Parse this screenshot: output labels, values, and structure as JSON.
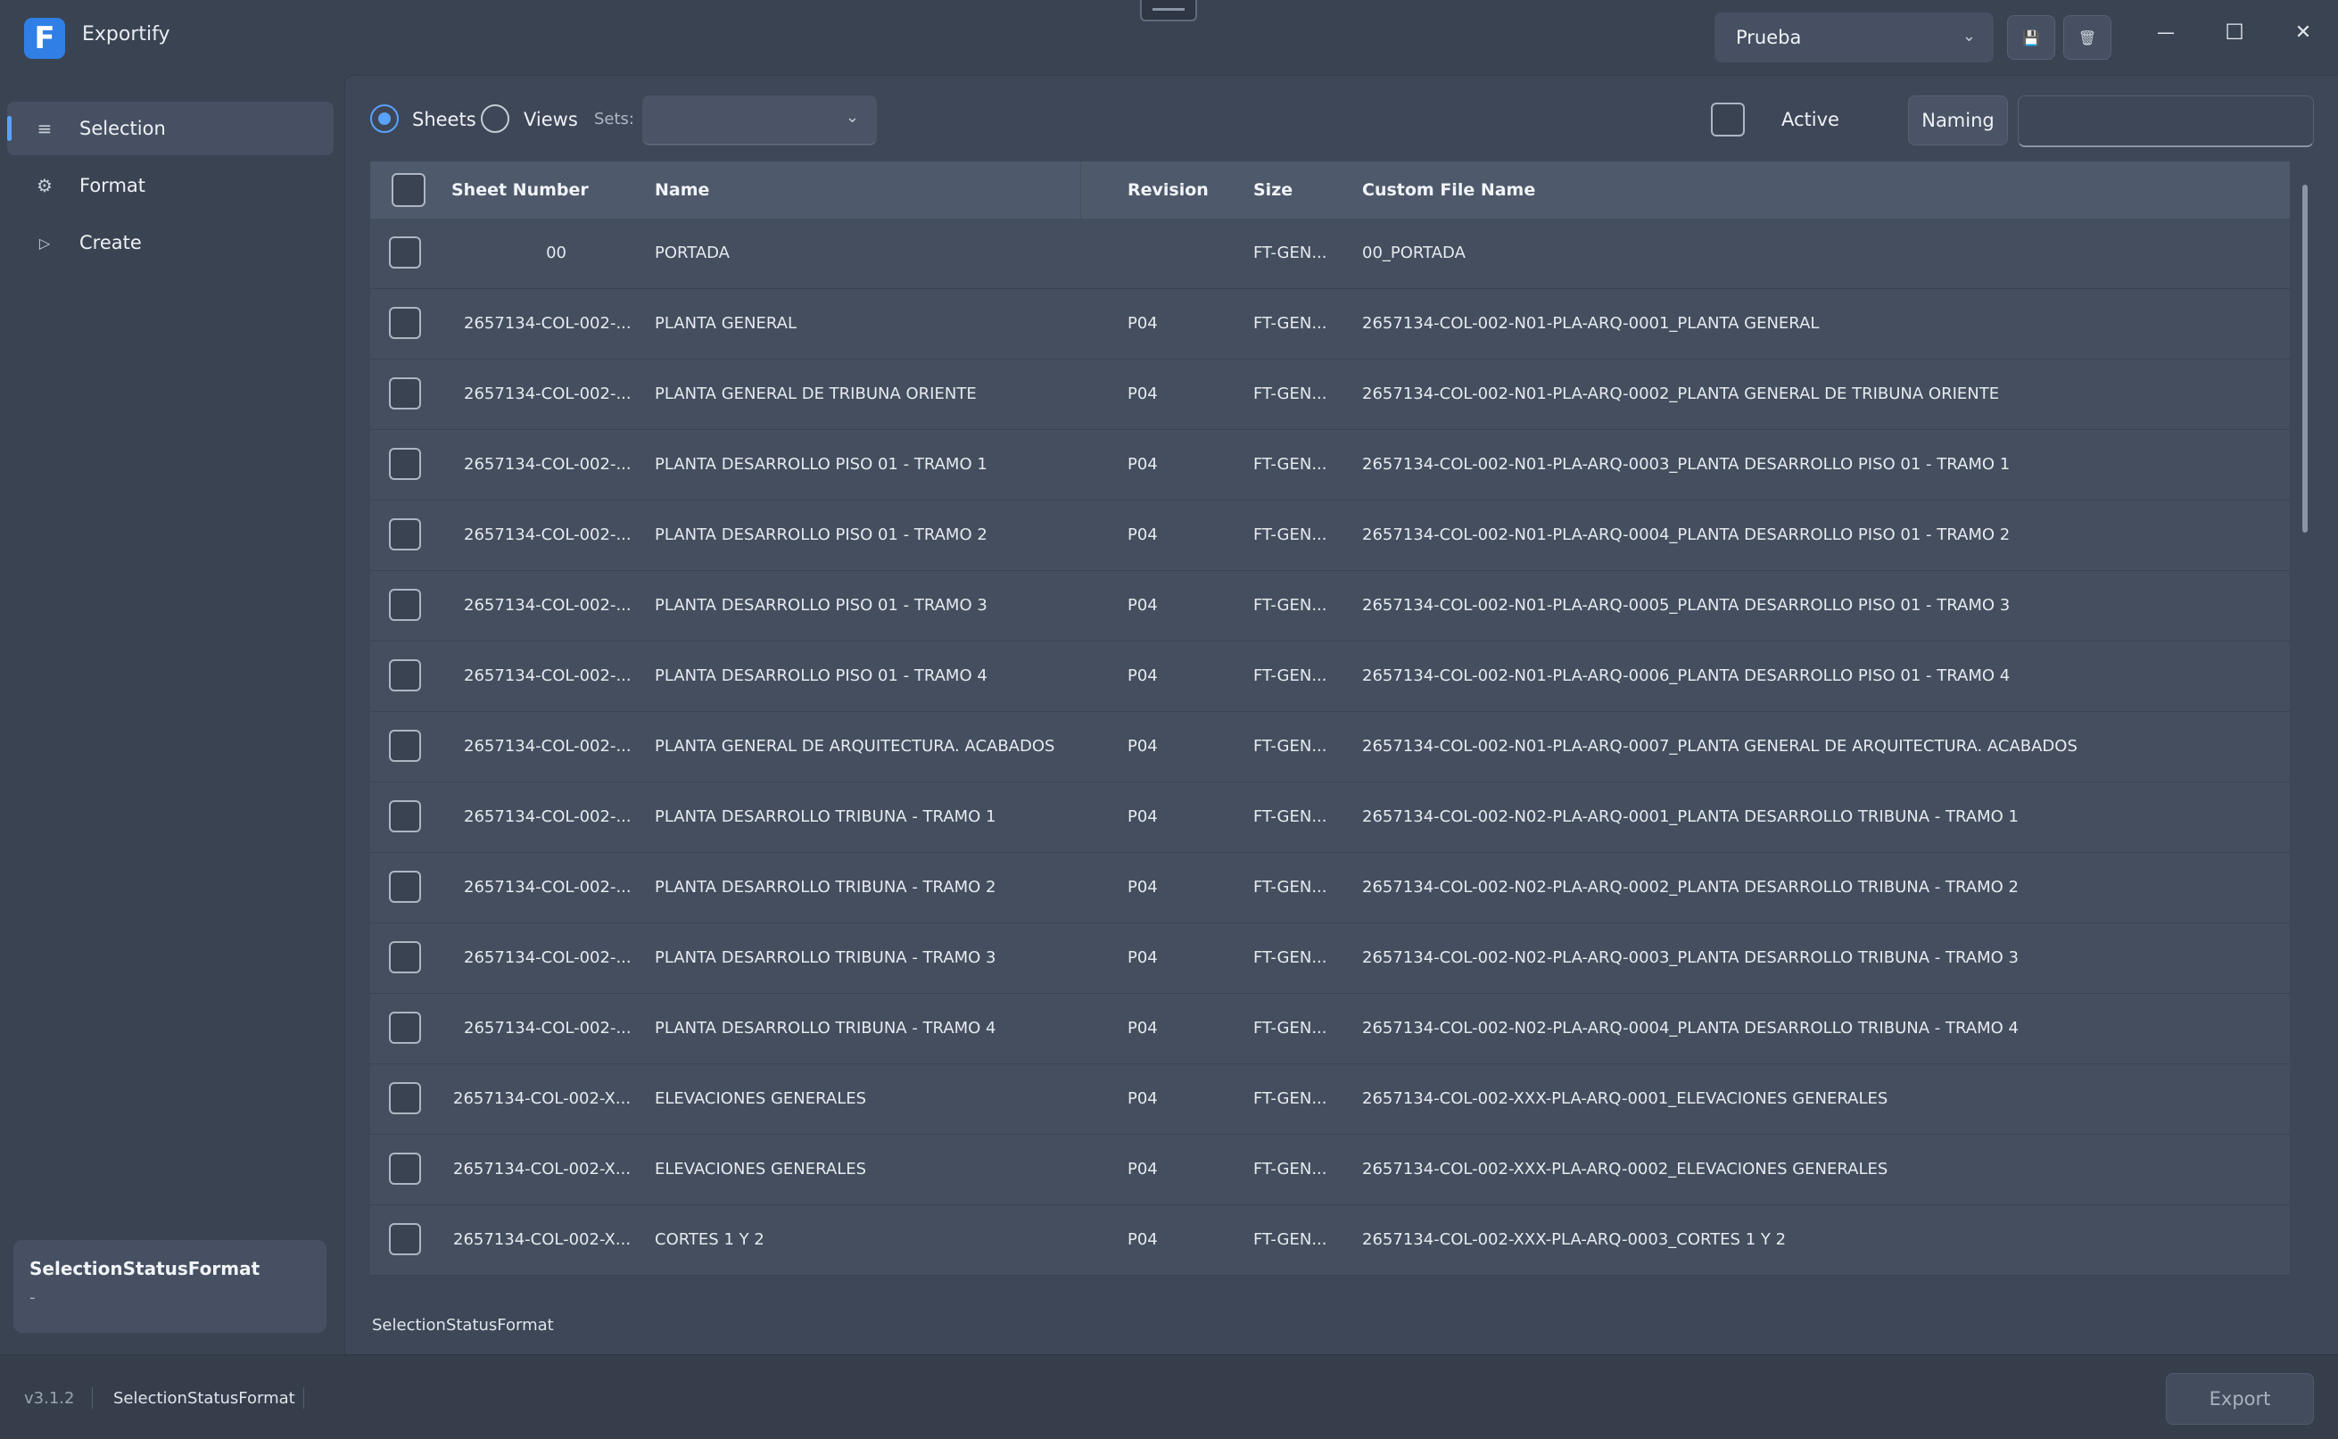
{
  "app": {
    "title": "Exportify",
    "logo_letter": "F",
    "version": "v3.1.2"
  },
  "header": {
    "profile_selected": "Prueba",
    "chevron": "⌄",
    "save_icon": "💾",
    "delete_icon": "🗑",
    "minimize": "—",
    "maximize": "☐",
    "close": "✕"
  },
  "sidebar": {
    "items": [
      {
        "label": "Selection",
        "icon": "≡"
      },
      {
        "label": "Format",
        "icon": "⚙"
      },
      {
        "label": "Create",
        "icon": "▷"
      }
    ],
    "status_card": {
      "title": "SelectionStatusFormat",
      "subtitle": "-"
    }
  },
  "toolbar": {
    "radio_sheets": "Sheets",
    "radio_views": "Views",
    "sets_label": "Sets:",
    "active_label": "Active",
    "naming_button": "Naming"
  },
  "table": {
    "columns": {
      "sheet_number": "Sheet Number",
      "name": "Name",
      "revision": "Revision",
      "size": "Size",
      "custom_file_name": "Custom File Name"
    },
    "rows": [
      {
        "number": "00",
        "name": "PORTADA",
        "revision": "",
        "size": "FT-GEN...",
        "file": "00_PORTADA",
        "align": "right"
      },
      {
        "number": "2657134-COL-002-...",
        "name": "PLANTA GENERAL",
        "revision": "P04",
        "size": "FT-GEN...",
        "file": "2657134-COL-002-N01-PLA-ARQ-0001_PLANTA GENERAL"
      },
      {
        "number": "2657134-COL-002-...",
        "name": "PLANTA GENERAL DE TRIBUNA ORIENTE",
        "revision": "P04",
        "size": "FT-GEN...",
        "file": "2657134-COL-002-N01-PLA-ARQ-0002_PLANTA GENERAL DE TRIBUNA ORIENTE"
      },
      {
        "number": "2657134-COL-002-...",
        "name": "PLANTA DESARROLLO PISO 01 - TRAMO 1",
        "revision": "P04",
        "size": "FT-GEN...",
        "file": "2657134-COL-002-N01-PLA-ARQ-0003_PLANTA DESARROLLO PISO 01 - TRAMO 1"
      },
      {
        "number": "2657134-COL-002-...",
        "name": "PLANTA DESARROLLO PISO 01 - TRAMO 2",
        "revision": "P04",
        "size": "FT-GEN...",
        "file": "2657134-COL-002-N01-PLA-ARQ-0004_PLANTA DESARROLLO PISO 01 - TRAMO 2"
      },
      {
        "number": "2657134-COL-002-...",
        "name": "PLANTA DESARROLLO PISO 01 - TRAMO 3",
        "revision": "P04",
        "size": "FT-GEN...",
        "file": "2657134-COL-002-N01-PLA-ARQ-0005_PLANTA DESARROLLO PISO 01 - TRAMO 3"
      },
      {
        "number": "2657134-COL-002-...",
        "name": "PLANTA DESARROLLO PISO 01 - TRAMO 4",
        "revision": "P04",
        "size": "FT-GEN...",
        "file": "2657134-COL-002-N01-PLA-ARQ-0006_PLANTA DESARROLLO PISO 01 - TRAMO 4"
      },
      {
        "number": "2657134-COL-002-...",
        "name": "PLANTA GENERAL DE ARQUITECTURA. ACABADOS",
        "revision": "P04",
        "size": "FT-GEN...",
        "file": "2657134-COL-002-N01-PLA-ARQ-0007_PLANTA GENERAL DE ARQUITECTURA. ACABADOS"
      },
      {
        "number": "2657134-COL-002-...",
        "name": "PLANTA DESARROLLO TRIBUNA - TRAMO 1",
        "revision": "P04",
        "size": "FT-GEN...",
        "file": "2657134-COL-002-N02-PLA-ARQ-0001_PLANTA DESARROLLO TRIBUNA - TRAMO 1"
      },
      {
        "number": "2657134-COL-002-...",
        "name": "PLANTA DESARROLLO TRIBUNA - TRAMO 2",
        "revision": "P04",
        "size": "FT-GEN...",
        "file": "2657134-COL-002-N02-PLA-ARQ-0002_PLANTA DESARROLLO TRIBUNA - TRAMO 2"
      },
      {
        "number": "2657134-COL-002-...",
        "name": "PLANTA DESARROLLO TRIBUNA - TRAMO 3",
        "revision": "P04",
        "size": "FT-GEN...",
        "file": "2657134-COL-002-N02-PLA-ARQ-0003_PLANTA DESARROLLO TRIBUNA - TRAMO 3"
      },
      {
        "number": "2657134-COL-002-...",
        "name": "PLANTA DESARROLLO TRIBUNA - TRAMO 4",
        "revision": "P04",
        "size": "FT-GEN...",
        "file": "2657134-COL-002-N02-PLA-ARQ-0004_PLANTA DESARROLLO TRIBUNA - TRAMO 4"
      },
      {
        "number": "2657134-COL-002-X...",
        "name": "ELEVACIONES GENERALES",
        "revision": "P04",
        "size": "FT-GEN...",
        "file": "2657134-COL-002-XXX-PLA-ARQ-0001_ELEVACIONES GENERALES"
      },
      {
        "number": "2657134-COL-002-X...",
        "name": "ELEVACIONES GENERALES",
        "revision": "P04",
        "size": "FT-GEN...",
        "file": "2657134-COL-002-XXX-PLA-ARQ-0002_ELEVACIONES GENERALES"
      },
      {
        "number": "2657134-COL-002-X...",
        "name": "CORTES 1 Y 2",
        "revision": "P04",
        "size": "FT-GEN...",
        "file": "2657134-COL-002-XXX-PLA-ARQ-0003_CORTES 1 Y 2"
      }
    ]
  },
  "status": {
    "bottom": "SelectionStatusFormat",
    "footer": "SelectionStatusFormat"
  },
  "footer": {
    "export_button": "Export"
  },
  "colors": {
    "accent": "#5aa2ff",
    "background": "#3a4352",
    "panel": "#3e4757"
  }
}
